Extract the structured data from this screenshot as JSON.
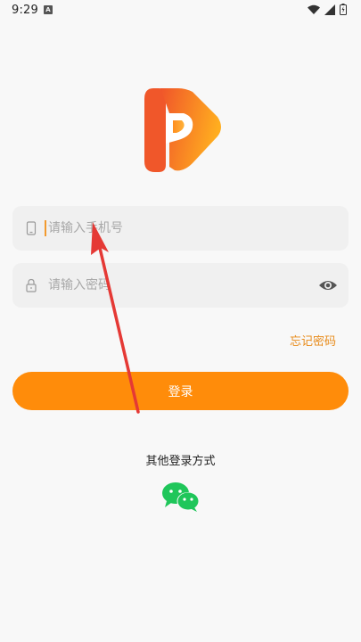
{
  "status_bar": {
    "time": "9:29",
    "notification_icon": "A"
  },
  "login": {
    "phone_placeholder": "请输入手机号",
    "password_placeholder": "请输入密码",
    "forgot_password": "忘记密码",
    "login_button": "登录",
    "other_methods": "其他登录方式"
  },
  "icons": {
    "logo": "app-logo-icon",
    "phone": "phone-icon",
    "lock": "lock-icon",
    "eye": "eye-icon",
    "wechat": "wechat-icon"
  },
  "colors": {
    "accent": "#ff8c0a",
    "forgot_link": "#e88b1a",
    "wechat": "#1fc65a",
    "annotation_arrow": "#e53935"
  }
}
